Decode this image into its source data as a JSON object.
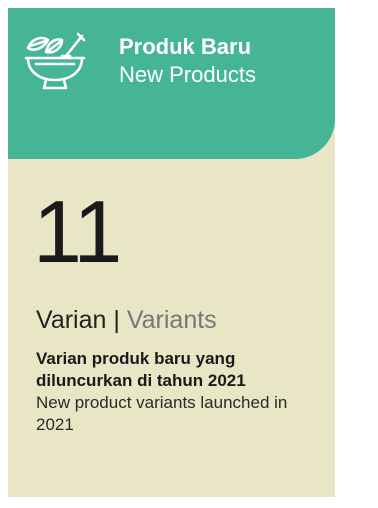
{
  "header": {
    "icon": "mortar-pestle-herbs-icon",
    "title_id": "Produk Baru",
    "title_en": "New Products"
  },
  "stat": {
    "value": "11",
    "unit_id": "Varian",
    "separator": "|",
    "unit_en": "Variants"
  },
  "description": {
    "text_id": "Varian produk baru yang diluncurkan di tahun 2021",
    "text_en": "New product variants launched in 2021"
  },
  "colors": {
    "header_bg": "#45b596",
    "card_bg": "#e9e6c6"
  }
}
